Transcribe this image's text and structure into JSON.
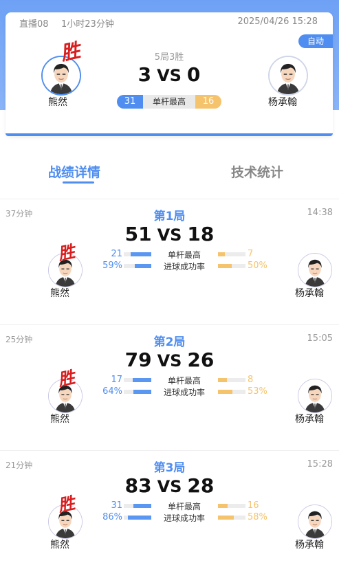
{
  "header": {
    "live_label": "直播08",
    "duration": "1小时23分钟",
    "datetime": "2025/04/26 15:28",
    "auto_label": "自动",
    "best_of": "5局3胜",
    "score_left": "3",
    "vs": "VS",
    "score_right": "0",
    "best_break_left": "31",
    "best_break_label": "单杆最高",
    "best_break_right": "16",
    "win_mark": "胜",
    "player_left": "熊然",
    "player_right": "杨承翰"
  },
  "tabs": {
    "details": "战绩详情",
    "stats": "技术统计"
  },
  "frames": [
    {
      "duration": "37分钟",
      "title": "第1局",
      "time": "14:38",
      "score_left": "51",
      "vs": "VS",
      "score_right": "18",
      "win_mark": "胜",
      "player_left": "熊然",
      "player_right": "杨承翰",
      "stat1_label": "单杆最高",
      "stat1_left": "21",
      "stat1_right": "7",
      "stat1_left_frac": 0.75,
      "stat1_right_frac": 0.25,
      "stat2_label": "进球成功率",
      "stat2_left": "59%",
      "stat2_right": "50%",
      "stat2_left_frac": 0.59,
      "stat2_right_frac": 0.5
    },
    {
      "duration": "25分钟",
      "title": "第2局",
      "time": "15:05",
      "score_left": "79",
      "vs": "VS",
      "score_right": "26",
      "win_mark": "胜",
      "player_left": "熊然",
      "player_right": "杨承翰",
      "stat1_label": "单杆最高",
      "stat1_left": "17",
      "stat1_right": "8",
      "stat1_left_frac": 0.68,
      "stat1_right_frac": 0.32,
      "stat2_label": "进球成功率",
      "stat2_left": "64%",
      "stat2_right": "53%",
      "stat2_left_frac": 0.64,
      "stat2_right_frac": 0.53
    },
    {
      "duration": "21分钟",
      "title": "第3局",
      "time": "15:28",
      "score_left": "83",
      "vs": "VS",
      "score_right": "28",
      "win_mark": "胜",
      "player_left": "熊然",
      "player_right": "杨承翰",
      "stat1_label": "单杆最高",
      "stat1_left": "31",
      "stat1_right": "16",
      "stat1_left_frac": 0.66,
      "stat1_right_frac": 0.34,
      "stat2_label": "进球成功率",
      "stat2_left": "86%",
      "stat2_right": "58%",
      "stat2_left_frac": 0.86,
      "stat2_right_frac": 0.58
    }
  ],
  "colors": {
    "primary_blue": "#4f8ef0",
    "accent_orange": "#f6c36d",
    "win_red": "#d81e1e"
  },
  "icons": {
    "avatar": "player-cartoon-avatar-icon"
  }
}
